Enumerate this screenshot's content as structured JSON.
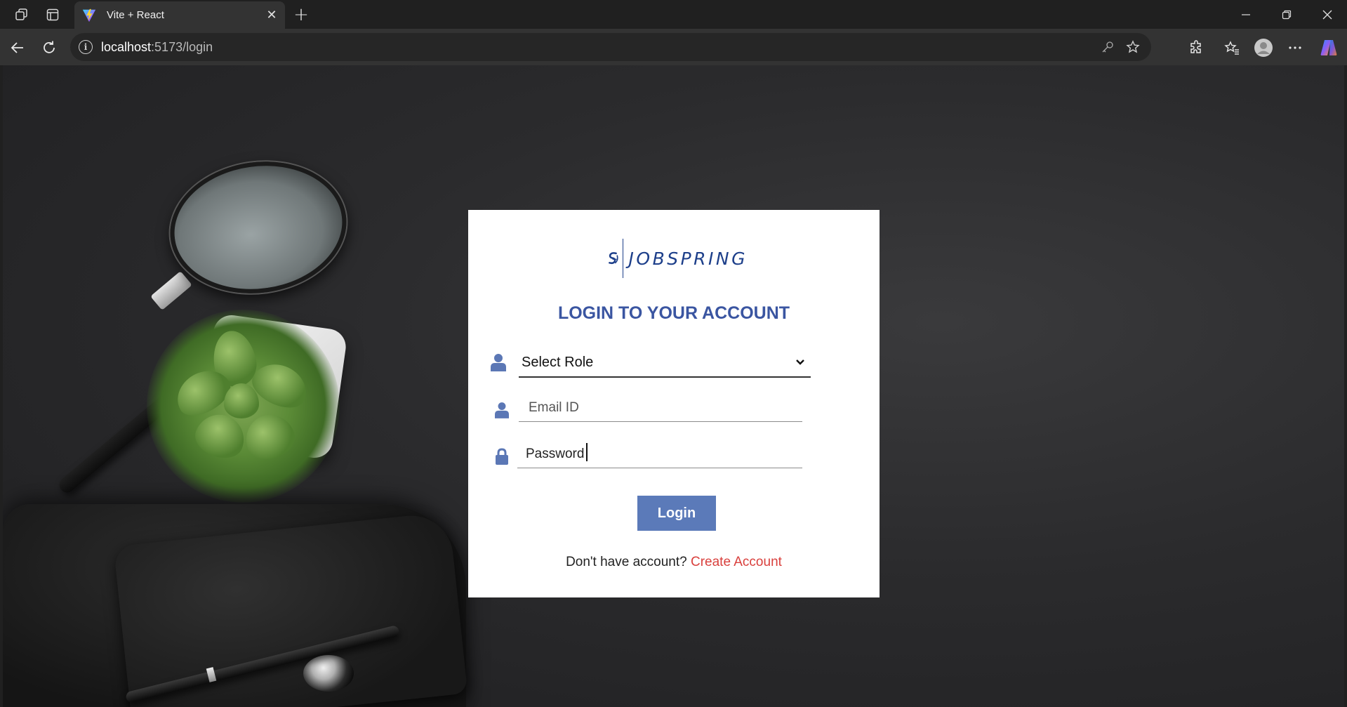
{
  "browser": {
    "tab_title": "Vite + React",
    "url_host": "localhost",
    "url_path": ":5173/login"
  },
  "login": {
    "logo_text": "JOBSPRING",
    "heading": "LOGIN TO YOUR ACCOUNT",
    "role_select_value": "Select Role",
    "email_placeholder": "Email ID",
    "password_value": "Password",
    "login_button": "Login",
    "footer_prompt": "Don't have account?",
    "create_account_link": "Create Account"
  },
  "colors": {
    "brand_blue": "#3a55a1",
    "button_blue": "#5b7ab9",
    "link_red": "#d9403d"
  },
  "icons": [
    "tab-actions-icon",
    "vertical-tabs-icon",
    "vite-favicon",
    "close-icon",
    "plus-icon",
    "minimize-icon",
    "restore-icon",
    "back-icon",
    "refresh-icon",
    "info-icon",
    "key-icon",
    "star-icon",
    "extensions-icon",
    "favorites-icon",
    "profile-icon",
    "more-icon",
    "copilot-icon",
    "user-icon",
    "lock-icon",
    "chevron-down-icon"
  ]
}
